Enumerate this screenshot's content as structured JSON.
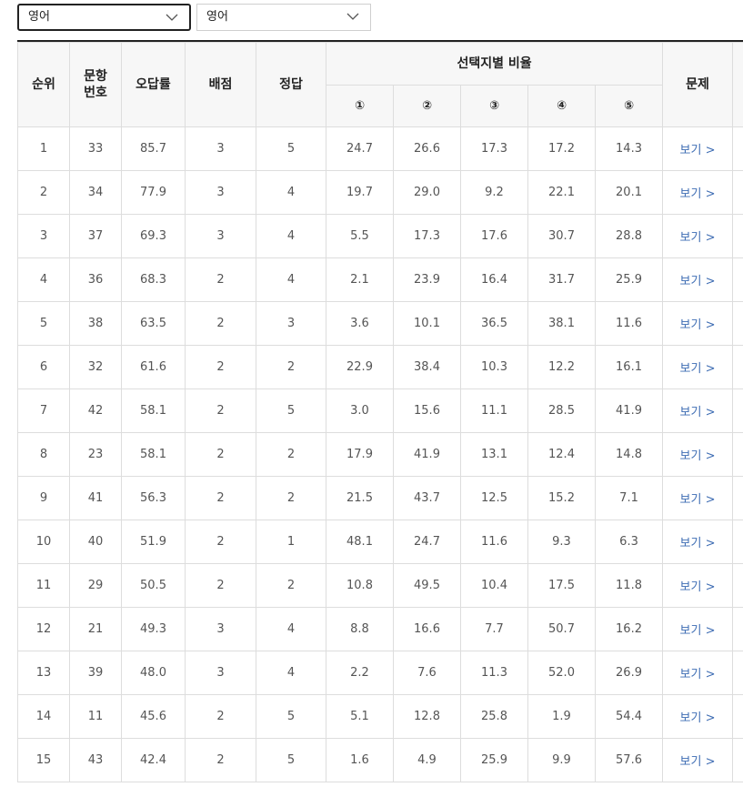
{
  "filters": {
    "subject1": "영어",
    "subject2": "영어"
  },
  "table": {
    "headers": {
      "rank": "순위",
      "question_no_line1": "문항",
      "question_no_line2": "번호",
      "error_rate": "오답률",
      "points": "배점",
      "answer": "정답",
      "choice_ratio": "선택지별 비율",
      "choices": [
        "①",
        "②",
        "③",
        "④",
        "⑤"
      ],
      "problem": "문제"
    },
    "view_label": "보기 >",
    "rows": [
      {
        "rank": "1",
        "no": "33",
        "error": "85.7",
        "points": "3",
        "answer": "5",
        "c": [
          "24.7",
          "26.6",
          "17.3",
          "17.2",
          "14.3"
        ]
      },
      {
        "rank": "2",
        "no": "34",
        "error": "77.9",
        "points": "3",
        "answer": "4",
        "c": [
          "19.7",
          "29.0",
          "9.2",
          "22.1",
          "20.1"
        ]
      },
      {
        "rank": "3",
        "no": "37",
        "error": "69.3",
        "points": "3",
        "answer": "4",
        "c": [
          "5.5",
          "17.3",
          "17.6",
          "30.7",
          "28.8"
        ]
      },
      {
        "rank": "4",
        "no": "36",
        "error": "68.3",
        "points": "2",
        "answer": "4",
        "c": [
          "2.1",
          "23.9",
          "16.4",
          "31.7",
          "25.9"
        ]
      },
      {
        "rank": "5",
        "no": "38",
        "error": "63.5",
        "points": "2",
        "answer": "3",
        "c": [
          "3.6",
          "10.1",
          "36.5",
          "38.1",
          "11.6"
        ]
      },
      {
        "rank": "6",
        "no": "32",
        "error": "61.6",
        "points": "2",
        "answer": "2",
        "c": [
          "22.9",
          "38.4",
          "10.3",
          "12.2",
          "16.1"
        ]
      },
      {
        "rank": "7",
        "no": "42",
        "error": "58.1",
        "points": "2",
        "answer": "5",
        "c": [
          "3.0",
          "15.6",
          "11.1",
          "28.5",
          "41.9"
        ]
      },
      {
        "rank": "8",
        "no": "23",
        "error": "58.1",
        "points": "2",
        "answer": "2",
        "c": [
          "17.9",
          "41.9",
          "13.1",
          "12.4",
          "14.8"
        ]
      },
      {
        "rank": "9",
        "no": "41",
        "error": "56.3",
        "points": "2",
        "answer": "2",
        "c": [
          "21.5",
          "43.7",
          "12.5",
          "15.2",
          "7.1"
        ]
      },
      {
        "rank": "10",
        "no": "40",
        "error": "51.9",
        "points": "2",
        "answer": "1",
        "c": [
          "48.1",
          "24.7",
          "11.6",
          "9.3",
          "6.3"
        ]
      },
      {
        "rank": "11",
        "no": "29",
        "error": "50.5",
        "points": "2",
        "answer": "2",
        "c": [
          "10.8",
          "49.5",
          "10.4",
          "17.5",
          "11.8"
        ]
      },
      {
        "rank": "12",
        "no": "21",
        "error": "49.3",
        "points": "3",
        "answer": "4",
        "c": [
          "8.8",
          "16.6",
          "7.7",
          "50.7",
          "16.2"
        ]
      },
      {
        "rank": "13",
        "no": "39",
        "error": "48.0",
        "points": "3",
        "answer": "4",
        "c": [
          "2.2",
          "7.6",
          "11.3",
          "52.0",
          "26.9"
        ]
      },
      {
        "rank": "14",
        "no": "11",
        "error": "45.6",
        "points": "2",
        "answer": "5",
        "c": [
          "5.1",
          "12.8",
          "25.8",
          "1.9",
          "54.4"
        ]
      },
      {
        "rank": "15",
        "no": "43",
        "error": "42.4",
        "points": "2",
        "answer": "5",
        "c": [
          "1.6",
          "4.9",
          "25.9",
          "9.9",
          "57.6"
        ]
      }
    ]
  }
}
